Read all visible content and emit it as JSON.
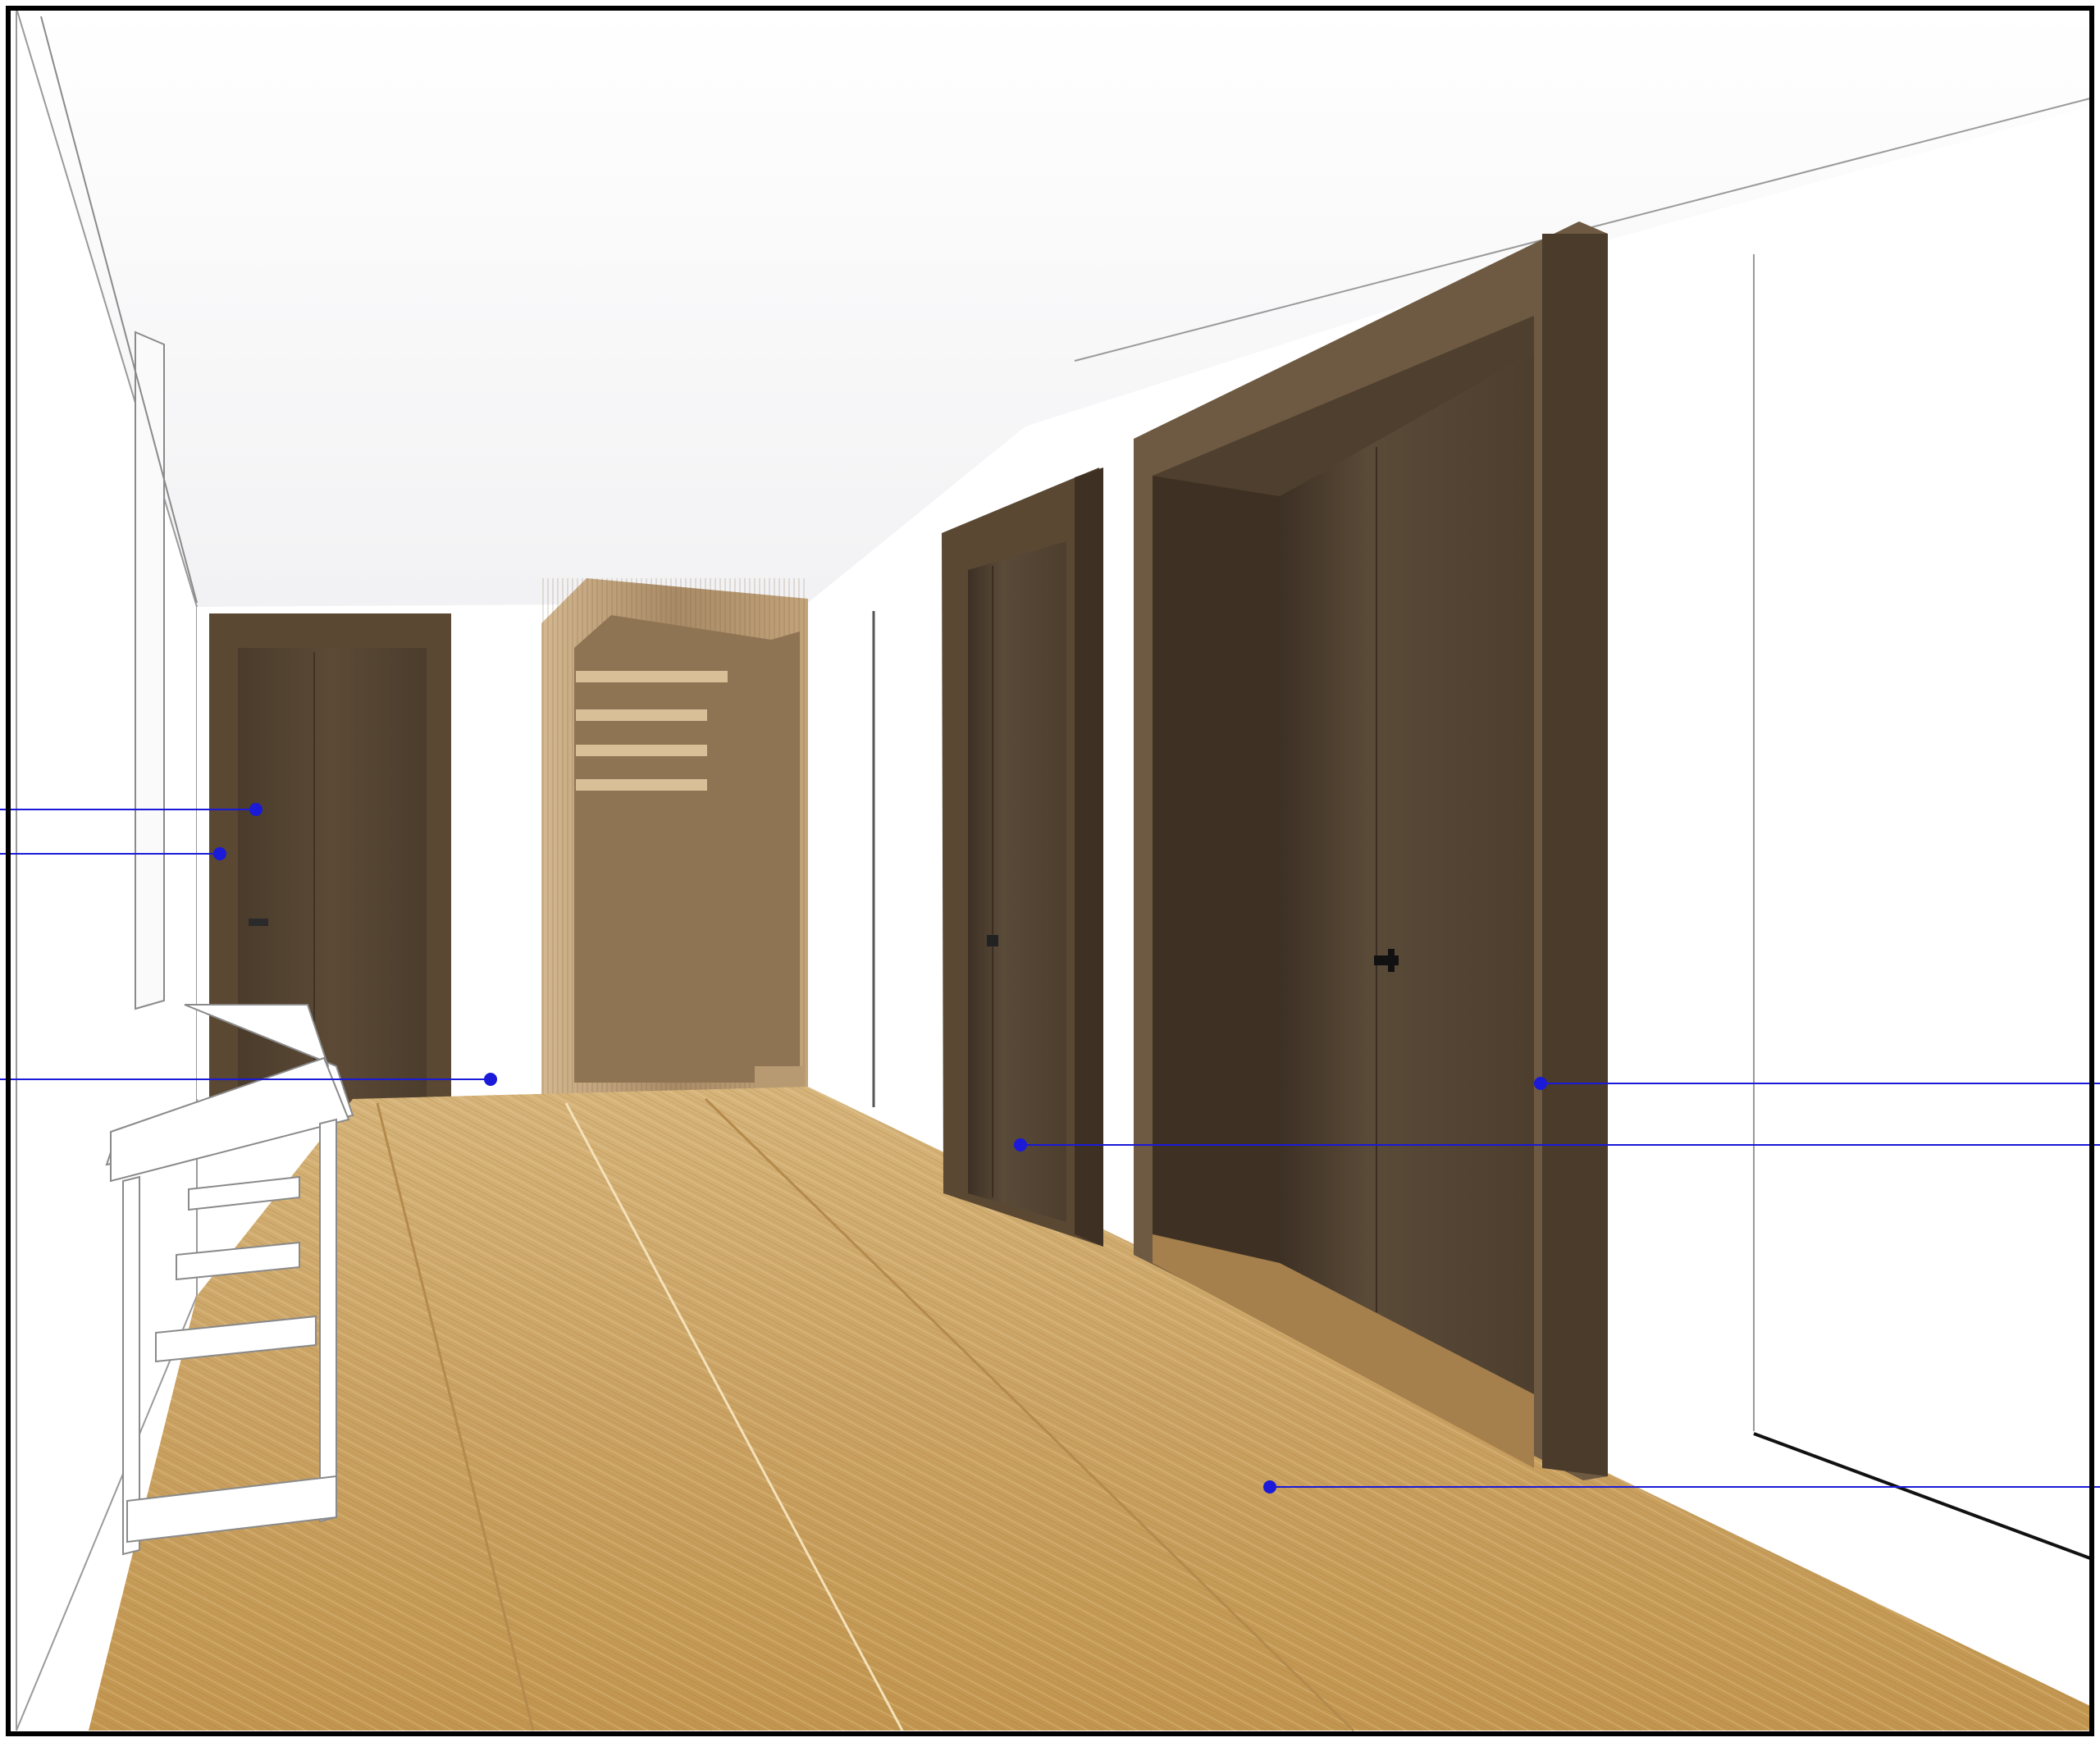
{
  "scene": {
    "description_visible_text": [],
    "colors": {
      "frame": "#000000",
      "wall": "#ffffff",
      "ceiling_shade": "#e9e9ec",
      "floor_light": "#d9b57a",
      "floor_mid": "#c89e5e",
      "floor_dark": "#a97e42",
      "walnut_light": "#6e5a42",
      "walnut": "#5a4833",
      "walnut_dark": "#3e3123",
      "oak_niche": "#c9a97c",
      "oak_niche_dark": "#8f7453",
      "annotation": "#1a1ad8",
      "line_gray": "#9a9a9a"
    }
  }
}
